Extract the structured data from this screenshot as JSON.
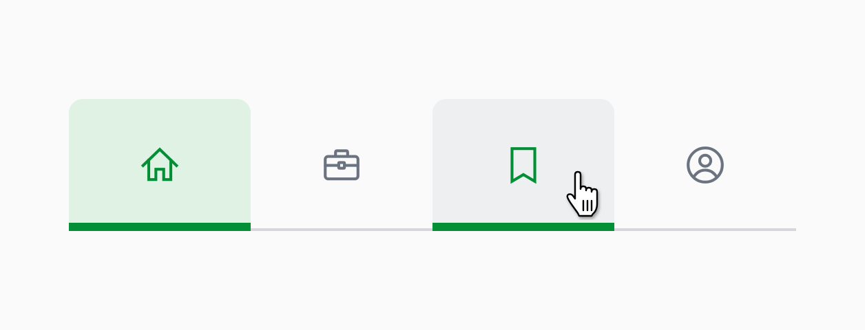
{
  "tabs": [
    {
      "id": "home",
      "icon": "home-icon",
      "state": "selected"
    },
    {
      "id": "work",
      "icon": "briefcase-icon",
      "state": "default"
    },
    {
      "id": "saved",
      "icon": "bookmark-icon",
      "state": "hover"
    },
    {
      "id": "profile",
      "icon": "user-circle-icon",
      "state": "default"
    }
  ],
  "colors": {
    "accent": "#038f35",
    "icon_inactive": "#6b7280",
    "selected_bg": "#dff2e4",
    "hover_bg": "#eeeff1",
    "baseline": "#d6d6dc",
    "page_bg": "#fafafa"
  },
  "cursor": {
    "icon": "hand-pointer-cursor"
  }
}
